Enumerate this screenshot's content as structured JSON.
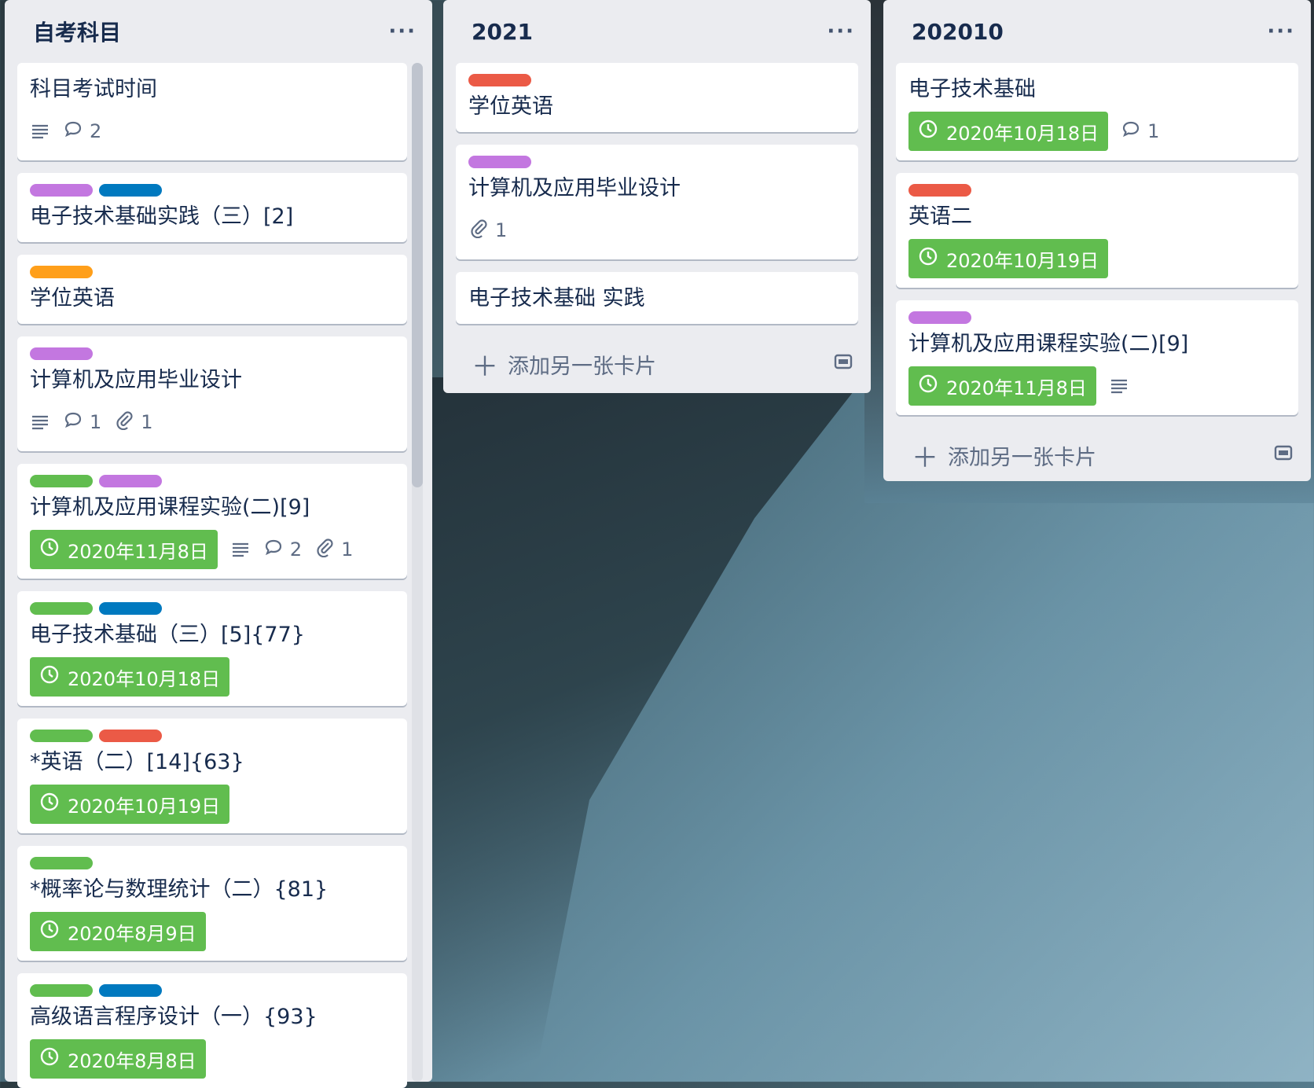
{
  "lists": [
    {
      "title": "自考科目",
      "cards": [
        {
          "title": "科目考试时间",
          "labels": [],
          "due": null,
          "description": true,
          "comments": "2",
          "attachments": null
        },
        {
          "title": "电子技术基础实践（三）[2]",
          "labels": [
            "#c377e0",
            "#0079bf"
          ],
          "due": null,
          "description": false,
          "comments": null,
          "attachments": null
        },
        {
          "title": "学位英语",
          "labels": [
            "#ff9f1a"
          ],
          "due": null,
          "description": false,
          "comments": null,
          "attachments": null
        },
        {
          "title": "计算机及应用毕业设计",
          "labels": [
            "#c377e0"
          ],
          "due": null,
          "description": true,
          "comments": "1",
          "attachments": "1"
        },
        {
          "title": "计算机及应用课程实验(二)[9]",
          "labels": [
            "#61bd4f",
            "#c377e0"
          ],
          "due": "2020年11月8日",
          "description": true,
          "comments": "2",
          "attachments": "1"
        },
        {
          "title": "电子技术基础（三）[5]{77}",
          "labels": [
            "#61bd4f",
            "#0079bf"
          ],
          "due": "2020年10月18日",
          "description": false,
          "comments": null,
          "attachments": null
        },
        {
          "title": "*英语（二）[14]{63}",
          "labels": [
            "#61bd4f",
            "#eb5a46"
          ],
          "due": "2020年10月19日",
          "description": false,
          "comments": null,
          "attachments": null
        },
        {
          "title": "*概率论与数理统计（二）{81}",
          "labels": [
            "#61bd4f"
          ],
          "due": "2020年8月9日",
          "description": false,
          "comments": null,
          "attachments": null
        },
        {
          "title": "高级语言程序设计（一）{93}",
          "labels": [
            "#61bd4f",
            "#0079bf"
          ],
          "due": "2020年8月8日",
          "description": false,
          "comments": null,
          "attachments": null
        }
      ]
    },
    {
      "title": "2021",
      "cards": [
        {
          "title": "学位英语",
          "labels": [
            "#eb5a46"
          ],
          "due": null,
          "description": false,
          "comments": null,
          "attachments": null
        },
        {
          "title": "计算机及应用毕业设计",
          "labels": [
            "#c377e0"
          ],
          "due": null,
          "description": false,
          "comments": null,
          "attachments": "1"
        },
        {
          "title": "电子技术基础 实践",
          "labels": [],
          "due": null,
          "description": false,
          "comments": null,
          "attachments": null
        }
      ],
      "add_card_label": "添加另一张卡片"
    },
    {
      "title": "202010",
      "cards": [
        {
          "title": "电子技术基础",
          "labels": [],
          "due": "2020年10月18日",
          "description": false,
          "comments": "1",
          "attachments": null
        },
        {
          "title": "英语二",
          "labels": [
            "#eb5a46"
          ],
          "due": "2020年10月19日",
          "description": false,
          "comments": null,
          "attachments": null
        },
        {
          "title": "计算机及应用课程实验(二)[9]",
          "labels": [
            "#c377e0"
          ],
          "due": "2020年11月8日",
          "description": true,
          "comments": null,
          "attachments": null
        }
      ],
      "add_card_label": "添加另一张卡片"
    }
  ],
  "menu_icon": "more-dots-icon",
  "due_color": "#61bd4f"
}
